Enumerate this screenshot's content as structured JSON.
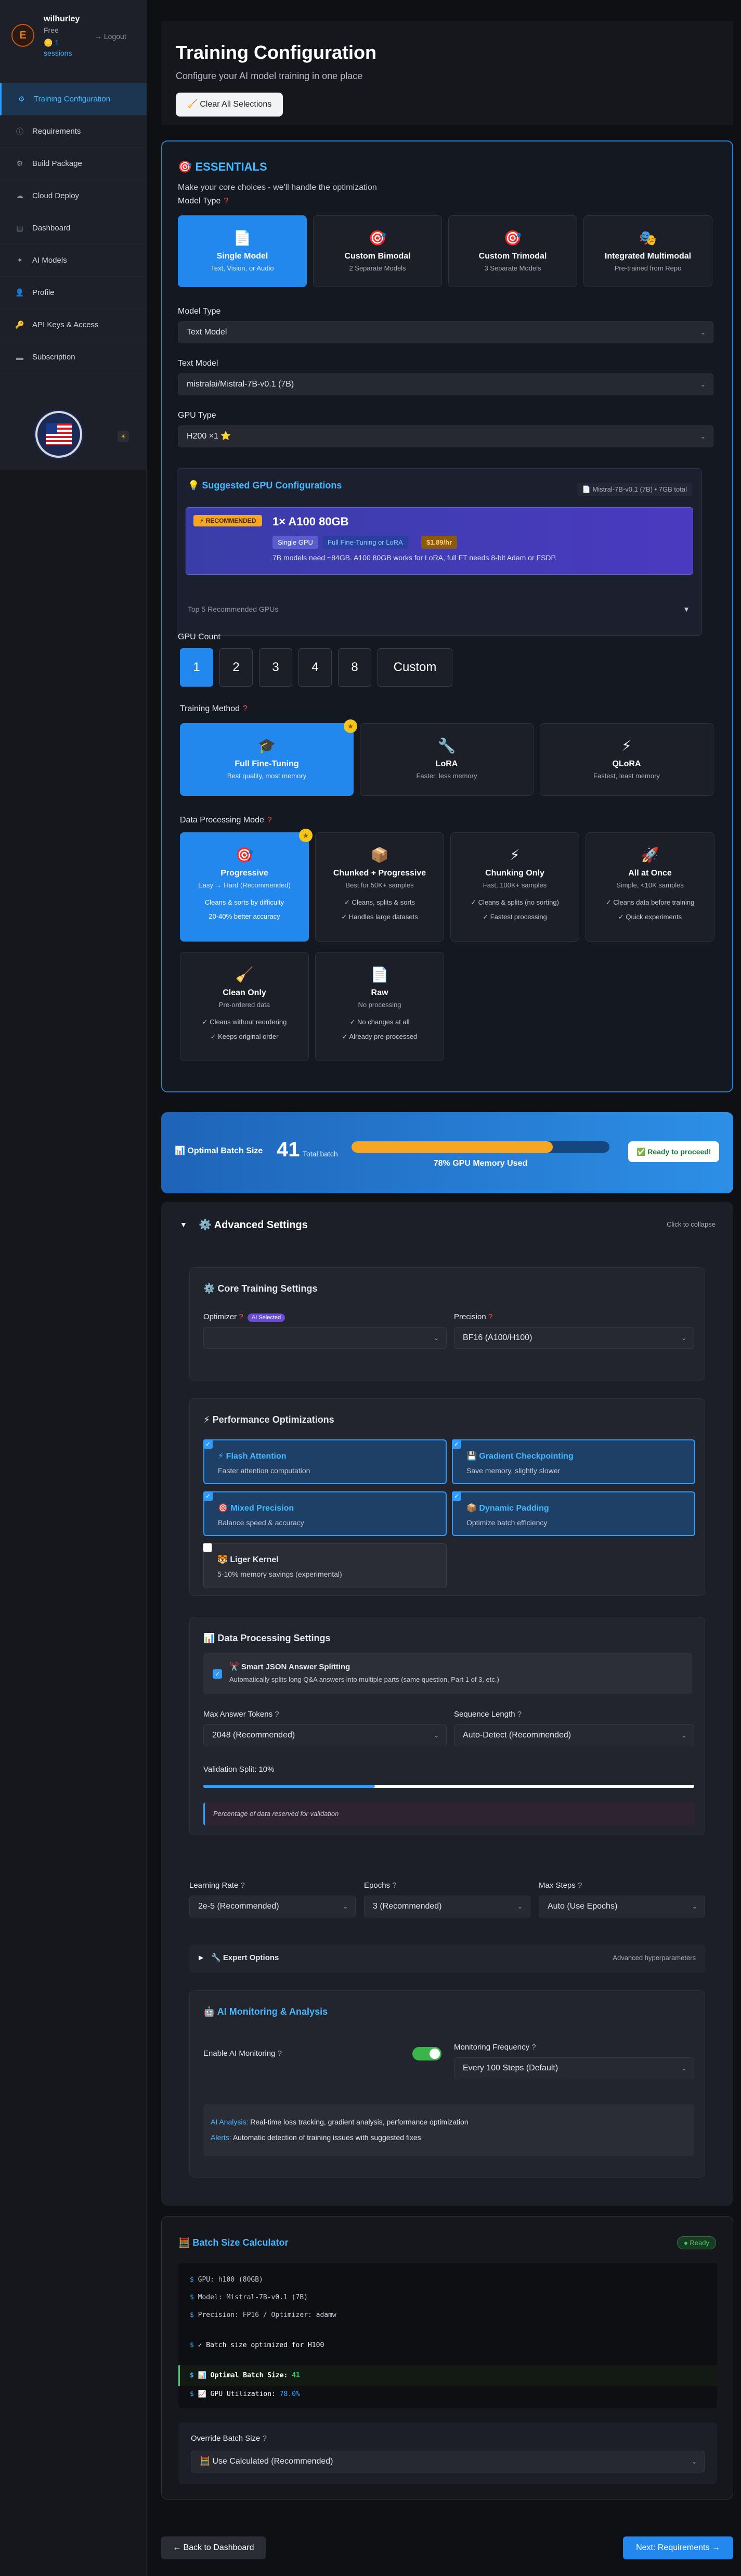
{
  "sidebar": {
    "user": {
      "initial": "E",
      "name": "wilhurley",
      "tier": "Free",
      "sessions": "🪙 1 sessions",
      "logout": "→ Logout"
    },
    "items": [
      {
        "icon": "⚙",
        "label": "Training Configuration"
      },
      {
        "icon": "ⓘ",
        "label": "Requirements"
      },
      {
        "icon": "⚙",
        "label": "Build Package"
      },
      {
        "icon": "☁",
        "label": "Cloud Deploy"
      },
      {
        "icon": "▤",
        "label": "Dashboard"
      },
      {
        "icon": "✦",
        "label": "AI Models"
      },
      {
        "icon": "👤",
        "label": "Profile"
      },
      {
        "icon": "🔑",
        "label": "API Keys & Access"
      },
      {
        "icon": "▬",
        "label": "Subscription"
      }
    ],
    "theme_icon": "☀"
  },
  "header": {
    "title": "Training Configuration",
    "subtitle": "Configure your AI model training in one place",
    "clear_btn": "🧹 Clear All Selections"
  },
  "essentials": {
    "title": "🎯 ESSENTIALS",
    "subtitle": "Make your core choices - we'll handle the optimization",
    "model_type_label": "Model Type",
    "model_types": [
      {
        "icon": "📄",
        "title": "Single Model",
        "sub": "Text, Vision, or Audio"
      },
      {
        "icon": "🎯",
        "title": "Custom Bimodal",
        "sub": "2 Separate Models"
      },
      {
        "icon": "🎯",
        "title": "Custom Trimodal",
        "sub": "3 Separate Models"
      },
      {
        "icon": "🎭",
        "title": "Integrated Multimodal",
        "sub": "Pre-trained from Repo"
      }
    ],
    "model_type2_label": "Model Type",
    "model_type2_value": "Text Model",
    "text_model_label": "Text Model",
    "text_model_value": "mistralai/Mistral-7B-v0.1 (7B)",
    "gpu_type_label": "GPU Type",
    "gpu_type_value": "H200 ×1 ⭐",
    "gpu": {
      "title": "💡 Suggested GPU Configurations",
      "meta": "📄 Mistral-7B-v0.1 (7B) • 7GB total",
      "badge": "⚡ RECOMMENDED",
      "name": "1× A100 80GB",
      "pill_single": "Single GPU",
      "pill_ft": "Full Fine-Tuning or LoRA",
      "pill_price": "$1.89/hr",
      "note": "7B models need ~84GB. A100 80GB works for LoRA, full FT needs 8-bit Adam or FSDP.",
      "more": "Top 5 Recommended GPUs",
      "more_caret": "▼"
    },
    "gpu_count_label": "GPU Count",
    "gpu_counts": [
      "1",
      "2",
      "3",
      "4",
      "8",
      "Custom"
    ],
    "method_label": "Training Method",
    "methods": [
      {
        "icon": "🎓",
        "title": "Full Fine-Tuning",
        "sub": "Best quality, most memory"
      },
      {
        "icon": "🔧",
        "title": "LoRA",
        "sub": "Faster, less memory"
      },
      {
        "icon": "⚡",
        "title": "QLoRA",
        "sub": "Fastest, least memory"
      }
    ],
    "dp_label": "Data Processing Mode",
    "dp_modes": [
      {
        "icon": "🎯",
        "title": "Progressive",
        "sub": "Easy → Hard (Recommended)",
        "l1": "Cleans & sorts by difficulty",
        "l2": "20-40% better accuracy"
      },
      {
        "icon": "📦",
        "title": "Chunked + Progressive",
        "sub": "Best for 50K+ samples",
        "l1": "✓ Cleans, splits & sorts",
        "l2": "✓ Handles large datasets"
      },
      {
        "icon": "⚡",
        "title": "Chunking Only",
        "sub": "Fast, 100K+ samples",
        "l1": "✓ Cleans & splits (no sorting)",
        "l2": "✓ Fastest processing"
      },
      {
        "icon": "🚀",
        "title": "All at Once",
        "sub": "Simple, <10K samples",
        "l1": "✓ Cleans data before training",
        "l2": "✓ Quick experiments"
      },
      {
        "icon": "🧹",
        "title": "Clean Only",
        "sub": "Pre-ordered data",
        "l1": "✓ Cleans without reordering",
        "l2": "✓ Keeps original order"
      },
      {
        "icon": "📄",
        "title": "Raw",
        "sub": "No processing",
        "l1": "✓ No changes at all",
        "l2": "✓ Already pre-processed"
      }
    ]
  },
  "batch": {
    "label": "📊 Optimal Batch Size",
    "value": "41",
    "unit": "Total batch",
    "memory_pct": 78,
    "memory_label": "78% GPU Memory Used",
    "ready": "✅ Ready to proceed!"
  },
  "advanced": {
    "title": "⚙️ Advanced Settings",
    "caret": "▼",
    "collapse": "Click to collapse",
    "core": {
      "title": "⚙️ Core Training Settings",
      "optimizer_label": "Optimizer",
      "ai_badge": "AI Selected",
      "optimizer_value": "",
      "precision_label": "Precision",
      "precision_value": "BF16 (A100/H100)"
    },
    "perf": {
      "title": "⚡ Performance Optimizations",
      "opts": [
        {
          "title": "⚡ Flash Attention",
          "sub": "Faster attention computation",
          "on": true
        },
        {
          "title": "💾 Gradient Checkpointing",
          "sub": "Save memory, slightly slower",
          "on": true
        },
        {
          "title": "🎯 Mixed Precision",
          "sub": "Balance speed & accuracy",
          "on": true
        },
        {
          "title": "📦 Dynamic Padding",
          "sub": "Optimize batch efficiency",
          "on": true
        },
        {
          "title": "🐯 Liger Kernel",
          "sub": "5-10% memory savings (experimental)",
          "on": false
        }
      ]
    },
    "data": {
      "title": "📊 Data Processing Settings",
      "json_title": "✂️ Smart JSON Answer Splitting",
      "json_sub": "Automatically splits long Q&A answers into multiple parts (same question, Part 1 of 3, etc.)",
      "max_tokens_label": "Max Answer Tokens",
      "max_tokens_value": "2048 (Recommended)",
      "seq_len_label": "Sequence Length",
      "seq_len_value": "Auto-Detect (Recommended)",
      "val_label": "Validation Split: 10%",
      "val_pct": 10,
      "val_note": "Percentage of data reserved for validation"
    },
    "lr_label": "Learning Rate",
    "lr_value": "2e-5 (Recommended)",
    "epochs_label": "Epochs",
    "epochs_value": "3 (Recommended)",
    "steps_label": "Max Steps",
    "steps_value": "Auto (Use Epochs)",
    "expert": {
      "caret": "▶",
      "title": "🔧 Expert Options",
      "right": "Advanced hyperparameters"
    },
    "monitor": {
      "title": "🤖 AI Monitoring & Analysis",
      "enable_label": "Enable AI Monitoring",
      "freq_label": "Monitoring Frequency",
      "freq_value": "Every 100 Steps (Default)",
      "analysis_k": "AI Analysis:",
      "analysis_v": "Real-time loss tracking, gradient analysis, performance optimization",
      "alerts_k": "Alerts:",
      "alerts_v": "Automatic detection of training issues with suggested fixes"
    }
  },
  "calc": {
    "title": "🧮 Batch Size Calculator",
    "ready": "● Ready",
    "lines": [
      "GPU: h100 (80GB)",
      "Model: Mistral-7B-v0.1 (7B)",
      "Precision: FP16 / Optimizer: adamw",
      "✓ Batch size optimized for H100"
    ],
    "opt_label": "📊 Optimal Batch Size:",
    "opt_value": "41",
    "util_label": "📈 GPU Utilization:",
    "util_value": "78.0%",
    "override_label": "Override Batch Size",
    "override_value": "🧮 Use Calculated (Recommended)"
  },
  "nav": {
    "back": "← Back to Dashboard",
    "next": "Next: Requirements →"
  }
}
